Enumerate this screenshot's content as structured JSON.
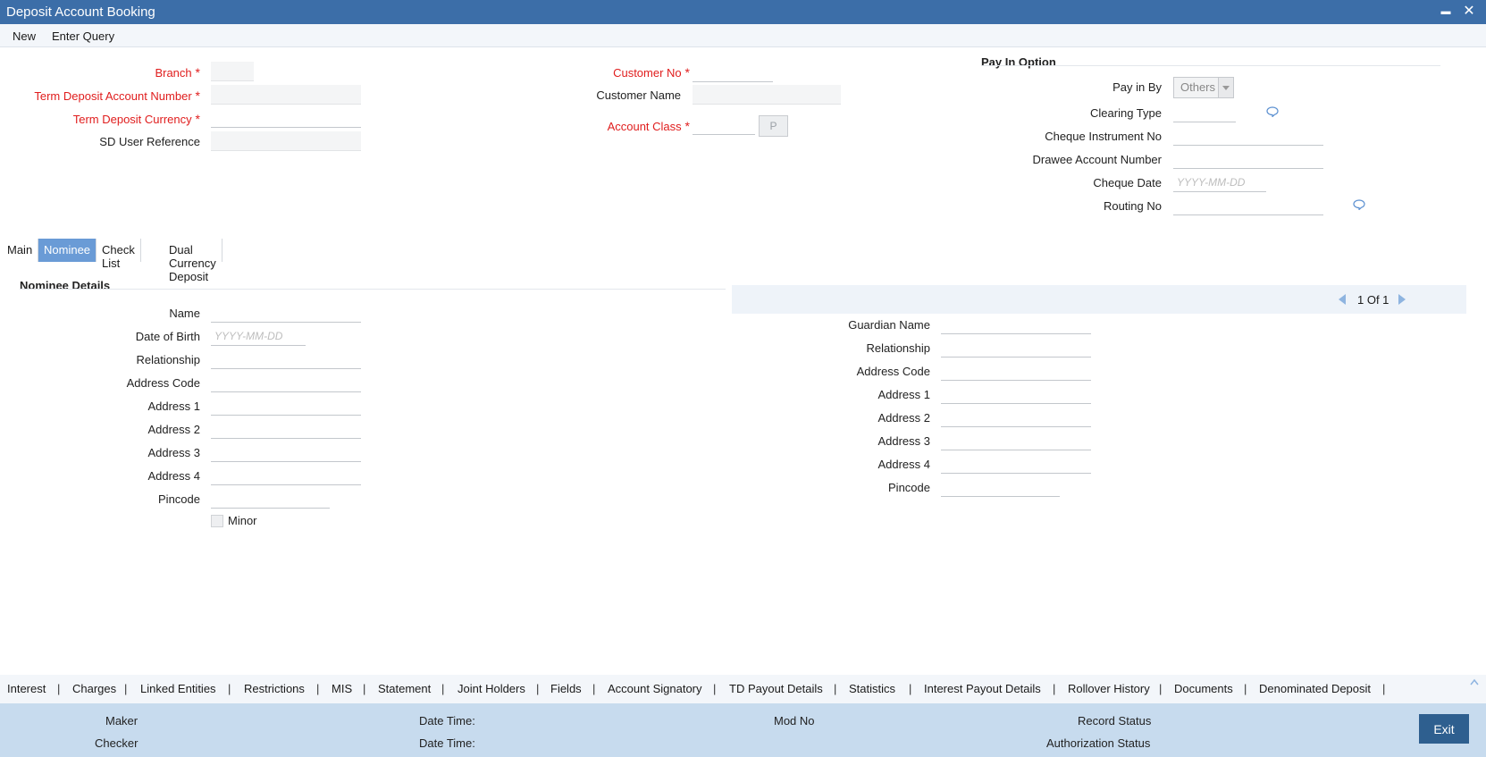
{
  "window": {
    "title": "Deposit Account Booking",
    "minimize_glyph": "▬",
    "close_glyph": "✕"
  },
  "menu": {
    "new": "New",
    "enter_query": "Enter Query"
  },
  "header": {
    "branch": "Branch",
    "td_account_number": "Term Deposit Account Number",
    "td_currency": "Term Deposit Currency",
    "sd_user_reference": "SD User Reference",
    "customer_no": "Customer No",
    "customer_name": "Customer Name",
    "account_class": "Account Class",
    "lov_button": "P"
  },
  "pay_in": {
    "title": "Pay In Option",
    "pay_in_by": "Pay in By",
    "pay_in_by_value": "Others",
    "clearing_type": "Clearing Type",
    "cheque_instrument_no": "Cheque Instrument No",
    "drawee_account_number": "Drawee Account Number",
    "cheque_date": "Cheque Date",
    "cheque_date_placeholder": "YYYY-MM-DD",
    "routing_no": "Routing No"
  },
  "tabs": {
    "main": "Main",
    "nominee": "Nominee",
    "check_list": "Check List",
    "dual_currency": "Dual Currency Deposit"
  },
  "nominee": {
    "title": "Nominee Details",
    "name": "Name",
    "dob": "Date of Birth",
    "dob_placeholder": "YYYY-MM-DD",
    "relationship": "Relationship",
    "address_code": "Address Code",
    "address1": "Address 1",
    "address2": "Address 2",
    "address3": "Address 3",
    "address4": "Address 4",
    "pincode": "Pincode",
    "minor": "Minor"
  },
  "guardian": {
    "pager": "1 Of 1",
    "guardian_name": "Guardian Name",
    "relationship": "Relationship",
    "address_code": "Address Code",
    "address1": "Address 1",
    "address2": "Address 2",
    "address3": "Address 3",
    "address4": "Address 4",
    "pincode": "Pincode"
  },
  "sublinks": {
    "items": [
      "Interest",
      "Charges",
      "Linked Entities",
      "Restrictions",
      "MIS",
      "Statement",
      "Joint Holders",
      "Fields",
      "Account Signatory",
      "TD Payout Details",
      "Statistics",
      "Interest Payout Details",
      "Rollover History",
      "Documents",
      "Denominated Deposit"
    ],
    "separator": "|"
  },
  "footer": {
    "maker": "Maker",
    "checker": "Checker",
    "date_time_1": "Date Time:",
    "date_time_2": "Date Time:",
    "mod_no": "Mod No",
    "record_status": "Record Status",
    "authorization_status": "Authorization Status",
    "exit": "Exit"
  },
  "colors": {
    "titlebar": "#3c6ea8",
    "active_tab": "#6a9bd6",
    "required": "#e01d1d",
    "footer": "#c7dbee",
    "exit_button": "#2e5f8f"
  }
}
